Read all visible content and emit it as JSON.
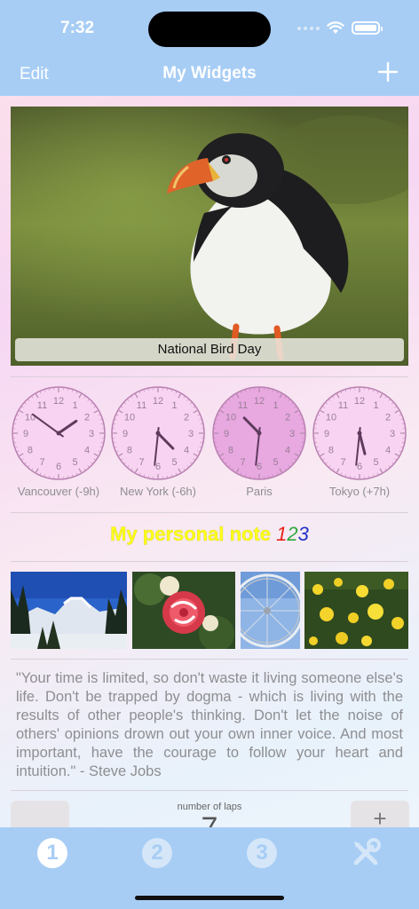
{
  "status_bar": {
    "time": "7:32"
  },
  "nav": {
    "edit_label": "Edit",
    "title": "My Widgets",
    "add_icon": "plus-icon"
  },
  "photo_widget": {
    "caption": "National Bird Day"
  },
  "clocks": [
    {
      "label": "Vancouver (-9h)",
      "hour": 1,
      "minute": 51,
      "shade": "light"
    },
    {
      "label": "New York (-6h)",
      "hour": 4,
      "minute": 31,
      "shade": "light"
    },
    {
      "label": "Paris",
      "hour": 10,
      "minute": 31,
      "shade": "dark"
    },
    {
      "label": "Tokyo (+7h)",
      "hour": 5,
      "minute": 31,
      "shade": "light"
    }
  ],
  "note": {
    "text": "My personal note ",
    "digit_1": "1",
    "digit_2": "2",
    "digit_3": "3"
  },
  "gallery": [
    "mountain-snow-photo",
    "flowers-photo",
    "ferris-wheel-photo",
    "yellow-roses-photo"
  ],
  "quote": {
    "text": "\"Your time is limited, so don't waste it living someone else's life. Don't be trapped by dogma - which is living with the results of other people's thinking. Don't let the noise of others' opinions drown out your own inner voice. And most important, have the courage to follow your heart and intuition.\" - Steve Jobs"
  },
  "laps": {
    "label": "number of laps",
    "value": "7",
    "minus_label": "",
    "plus_label": "+"
  },
  "tabs": [
    {
      "label": "1",
      "active": true
    },
    {
      "label": "2",
      "active": false
    },
    {
      "label": "3",
      "active": false
    },
    {
      "icon": "tools-icon"
    }
  ],
  "colors": {
    "accent": "#a7cdf5",
    "note_yellow": "#ffff1a"
  }
}
